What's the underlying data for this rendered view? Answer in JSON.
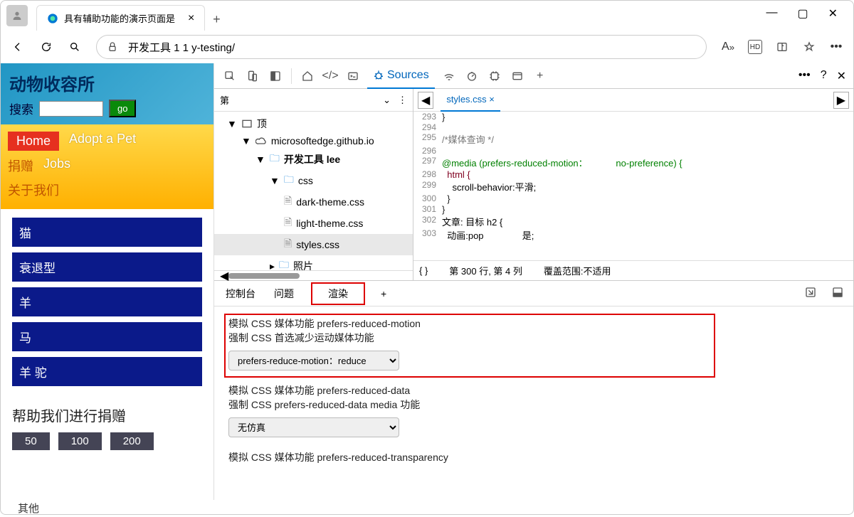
{
  "browser": {
    "tab_title": "具有辅助功能的演示页面是",
    "url": "开发工具 1 1 y-testing/"
  },
  "page": {
    "site_title": "动物收容所",
    "search_label": "搜索",
    "go_label": "go",
    "nav": {
      "home": "Home",
      "adopt": "Adopt a Pet",
      "donate": "捐赠",
      "jobs": "Jobs",
      "about": "关于我们"
    },
    "animals": [
      "猫",
      "衰退型",
      "羊",
      "马",
      "羊 驼"
    ],
    "donate_heading": "帮助我们进行捐赠",
    "donate_buttons": [
      "50",
      "100",
      "200"
    ],
    "other": "其他"
  },
  "devtools": {
    "active_tab": "Sources",
    "file_panel_label": "第",
    "tree": {
      "top": "顶",
      "domain": "microsoftedge.github.io",
      "project": "开发工具 lee",
      "css_folder": "css",
      "files": [
        "dark-theme.css",
        "light-theme.css",
        "styles.css"
      ],
      "photos": "照片"
    },
    "code": {
      "open_file": "styles.css",
      "lines": [
        {
          "n": "293",
          "t": "}"
        },
        {
          "n": "294",
          "t": ""
        },
        {
          "n": "295",
          "t": "/*媒体查询 */"
        },
        {
          "n": "296",
          "t": ""
        },
        {
          "n": "297",
          "t": "@media (prefers-reduced-motion：           no-preference) {"
        },
        {
          "n": "298",
          "t": "  html {"
        },
        {
          "n": "299",
          "t": "    scroll-behavior:平滑;"
        },
        {
          "n": "300",
          "t": "  }"
        },
        {
          "n": "301",
          "t": "}"
        },
        {
          "n": "302",
          "t": "文章: 目标 h2 {"
        },
        {
          "n": "303",
          "t": "  动画:pop               是;"
        }
      ],
      "pretty": "{ }",
      "status_pos": "第 300 行, 第 4 列",
      "status_coverage": "覆盖范围:不适用"
    },
    "drawer": {
      "tabs": [
        "控制台",
        "问题",
        "渲染"
      ],
      "opt1_title": "模拟 CSS 媒体功能 prefers-reduced-motion",
      "opt1_sub": "强制 CSS 首选减少运动媒体功能",
      "opt1_value": "prefers-reduce-motion：reduce",
      "opt2_title": "模拟 CSS 媒体功能 prefers-reduced-data",
      "opt2_sub": "强制 CSS prefers-reduced-data media 功能",
      "opt2_value": "无仿真",
      "opt3_title": "模拟 CSS 媒体功能 prefers-reduced-transparency"
    }
  }
}
